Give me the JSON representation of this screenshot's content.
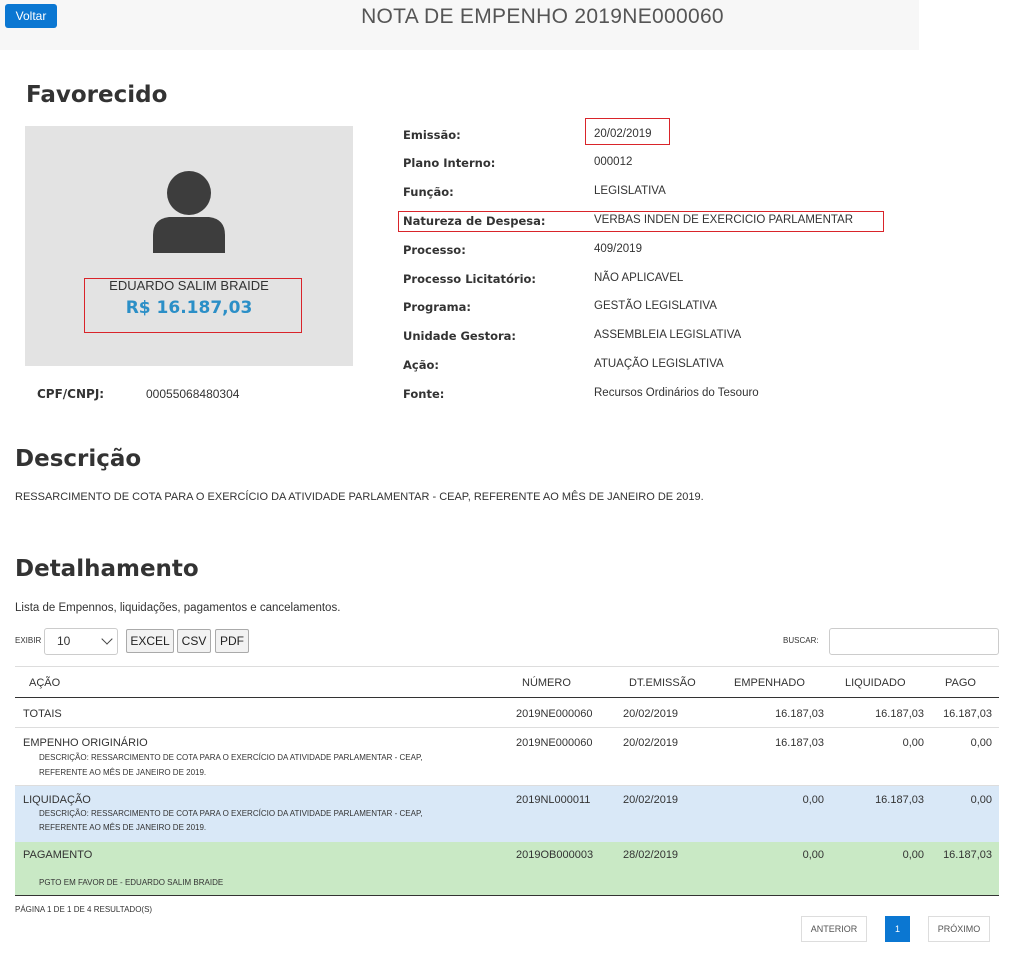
{
  "header": {
    "back_label": "Voltar",
    "title": "NOTA DE EMPENHO 2019NE000060"
  },
  "favorecido": {
    "heading": "Favorecido",
    "name": "EDUARDO SALIM BRAIDE",
    "value": "R$ 16.187,03",
    "cpf_label": "CPF/CNPJ:",
    "cpf_value": "00055068480304",
    "avatar_icon": "user-icon"
  },
  "info": [
    {
      "label": "Emissão:",
      "value": "20/02/2019"
    },
    {
      "label": "Plano Interno:",
      "value": "000012"
    },
    {
      "label": "Função:",
      "value": "LEGISLATIVA"
    },
    {
      "label": "Natureza de Despesa:",
      "value": "VERBAS INDEN DE EXERCICIO PARLAMENTAR"
    },
    {
      "label": "Processo:",
      "value": "409/2019"
    },
    {
      "label": "Processo Licitatório:",
      "value": "NÃO APLICAVEL"
    },
    {
      "label": "Programa:",
      "value": "GESTÃO LEGISLATIVA"
    },
    {
      "label": "Unidade Gestora:",
      "value": "ASSEMBLEIA LEGISLATIVA"
    },
    {
      "label": "Ação:",
      "value": "ATUAÇÃO LEGISLATIVA"
    },
    {
      "label": "Fonte:",
      "value": "Recursos Ordinários do Tesouro"
    }
  ],
  "descricao": {
    "heading": "Descrição",
    "text": "RESSARCIMENTO DE COTA PARA O EXERCÍCIO DA ATIVIDADE PARLAMENTAR - CEAP, REFERENTE AO MÊS DE JANEIRO DE 2019."
  },
  "detalhamento": {
    "heading": "Detalhamento",
    "subtitle": "Lista de Empennos, liquidações, pagamentos e cancelamentos.",
    "exibir_label": "EXIBIR",
    "exibir_value": "10",
    "buttons": [
      "EXCEL",
      "CSV",
      "PDF"
    ],
    "buscar_label": "BUSCAR:",
    "columns": [
      "AÇÃO",
      "NÚMERO",
      "DT.EMISSÃO",
      "EMPENHADO",
      "LIQUIDADO",
      "PAGO"
    ],
    "rows": [
      {
        "acao": "TOTAIS",
        "numero": "2019NE000060",
        "data": "20/02/2019",
        "empenhado": "16.187,03",
        "liquidado": "16.187,03",
        "pago": "16.187,03"
      },
      {
        "acao": "EMPENHO ORIGINÁRIO",
        "numero": "2019NE000060",
        "data": "20/02/2019",
        "empenhado": "16.187,03",
        "liquidado": "0,00",
        "pago": "0,00",
        "desc1": "DESCRIÇÃO: RESSARCIMENTO DE COTA PARA O EXERCÍCIO DA ATIVIDADE PARLAMENTAR - CEAP,",
        "desc2": "REFERENTE AO MÊS DE JANEIRO DE 2019."
      },
      {
        "acao": "LIQUIDAÇÃO",
        "numero": "2019NL000011",
        "data": "20/02/2019",
        "empenhado": "0,00",
        "liquidado": "16.187,03",
        "pago": "0,00",
        "desc1": "DESCRIÇÃO: RESSARCIMENTO DE COTA PARA O EXERCÍCIO DA ATIVIDADE PARLAMENTAR - CEAP,",
        "desc2": "REFERENTE AO MÊS DE JANEIRO DE 2019."
      },
      {
        "acao": "PAGAMENTO",
        "numero": "2019OB000003",
        "data": "28/02/2019",
        "empenhado": "0,00",
        "liquidado": "0,00",
        "pago": "16.187,03",
        "desc1": "PGTO EM FAVOR DE - EDUARDO SALIM BRAIDE"
      }
    ],
    "pagination_info": "PÁGINA 1 DE 1 DE 4 RESULTADO(S)",
    "prev_label": "ANTERIOR",
    "current_page": "1",
    "next_label": "PRÓXIMO"
  }
}
